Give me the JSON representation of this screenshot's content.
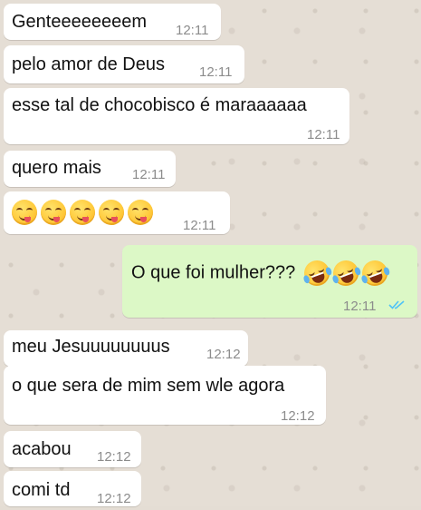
{
  "messages": [
    {
      "text": "Genteeeeeeeem",
      "time": "12:11",
      "direction": "in"
    },
    {
      "text": "pelo amor de Deus",
      "time": "12:11",
      "direction": "in"
    },
    {
      "text": "esse tal de chocobisco é maraaaaaa",
      "time": "12:11",
      "direction": "in"
    },
    {
      "text": "quero mais",
      "time": "12:11",
      "direction": "in"
    },
    {
      "emojis": [
        "yum-face-icon",
        "yum-face-icon",
        "yum-face-icon",
        "yum-face-icon",
        "yum-face-icon"
      ],
      "time": "12:11",
      "direction": "in"
    },
    {
      "text": "O que foi mulher???",
      "emojis": [
        "tears-of-joy-icon",
        "tears-of-joy-icon",
        "tears-of-joy-icon"
      ],
      "time": "12:11",
      "direction": "out",
      "status": "read",
      "status_icon": "double-check-icon"
    },
    {
      "text": "meu Jesuuuuuuuus",
      "time": "12:12",
      "direction": "in"
    },
    {
      "text": "o que sera de mim sem wle agora",
      "time": "12:12",
      "direction": "in"
    },
    {
      "text": "acabou",
      "time": "12:12",
      "direction": "in"
    },
    {
      "text": "comi td",
      "time": "12:12",
      "direction": "in"
    }
  ],
  "colors": {
    "incoming_bubble": "#ffffff",
    "outgoing_bubble": "#dcf8c6",
    "wallpaper": "#e5ded5",
    "timestamp": "#8c8c8c",
    "read_ticks": "#4fc3f7"
  }
}
